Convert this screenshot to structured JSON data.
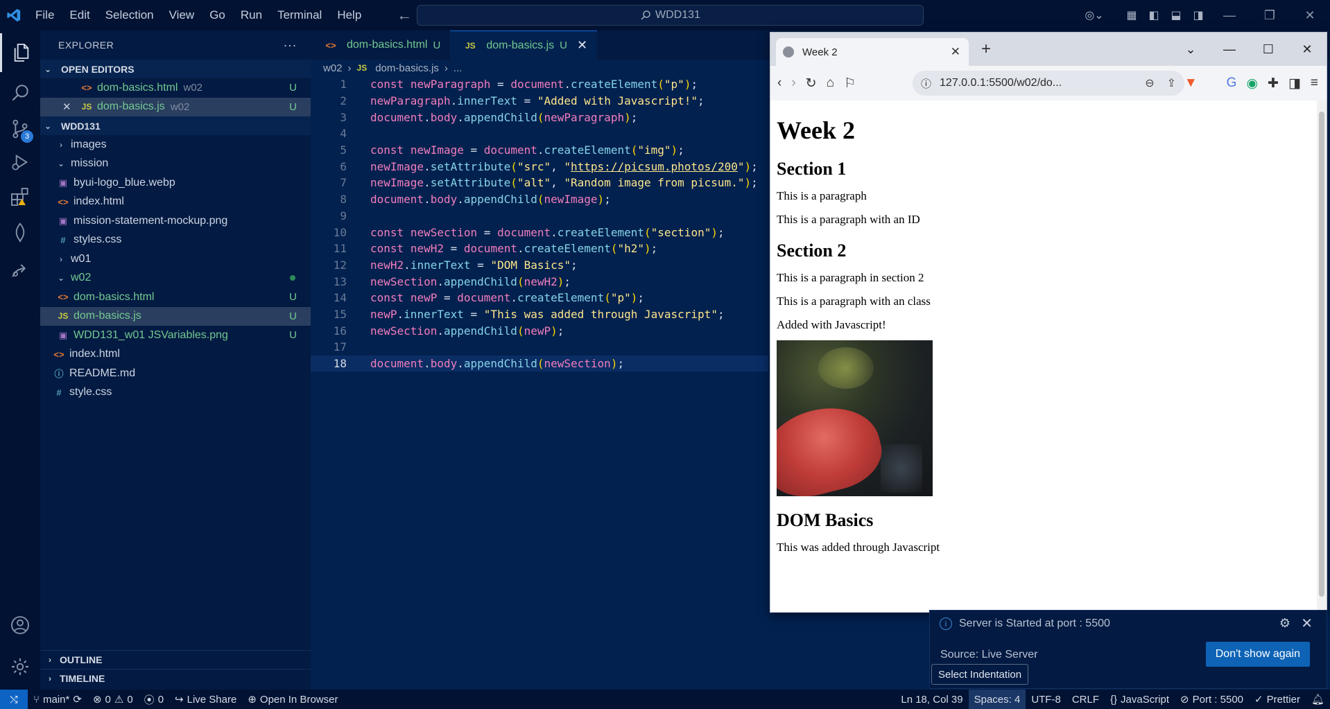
{
  "titlebar": {
    "menu": [
      "File",
      "Edit",
      "Selection",
      "View",
      "Go",
      "Run",
      "Terminal",
      "Help"
    ],
    "search_text": "WDD131"
  },
  "activity": {
    "source_control_badge": "3"
  },
  "explorer": {
    "title": "EXPLORER",
    "open_editors_label": "OPEN EDITORS",
    "open_editors": [
      {
        "name": "dom-basics.html",
        "dir": "w02",
        "status": "U"
      },
      {
        "name": "dom-basics.js",
        "dir": "w02",
        "status": "U"
      }
    ],
    "workspace_label": "WDD131",
    "tree": [
      {
        "name": "images"
      },
      {
        "name": "mission"
      },
      {
        "name": "byui-logo_blue.webp"
      },
      {
        "name": "index.html"
      },
      {
        "name": "mission-statement-mockup.png"
      },
      {
        "name": "styles.css"
      },
      {
        "name": "w01"
      },
      {
        "name": "w02"
      },
      {
        "name": "dom-basics.html",
        "status": "U"
      },
      {
        "name": "dom-basics.js",
        "status": "U"
      },
      {
        "name": "WDD131_w01 JSVariables.png",
        "status": "U"
      },
      {
        "name": "index.html"
      },
      {
        "name": "README.md"
      },
      {
        "name": "style.css"
      }
    ],
    "outline_label": "OUTLINE",
    "timeline_label": "TIMELINE"
  },
  "editor": {
    "tabs": [
      {
        "label": "dom-basics.html",
        "status": "U"
      },
      {
        "label": "dom-basics.js",
        "status": "U"
      }
    ],
    "breadcrumb": {
      "folder": "w02",
      "file": "dom-basics.js",
      "more": "..."
    },
    "line_numbers": [
      "1",
      "2",
      "3",
      "4",
      "5",
      "6",
      "7",
      "8",
      "9",
      "10",
      "11",
      "12",
      "13",
      "14",
      "15",
      "16",
      "17",
      "18"
    ]
  },
  "browser": {
    "tab_title": "Week 2",
    "url": "127.0.0.1:5500/w02/do...",
    "page": {
      "h1": "Week 2",
      "section1_heading": "Section 1",
      "p1": "This is a paragraph",
      "p2": "This is a paragraph with an ID",
      "section2_heading": "Section 2",
      "p3": "This is a paragraph in section 2",
      "p4": "This is a paragraph with an class",
      "p5": "Added with Javascript!",
      "dom_heading": "DOM Basics",
      "p6": "This was added through Javascript"
    }
  },
  "notification": {
    "message": "Server is Started at port : 5500",
    "source": "Source: Live Server",
    "button": "Don't show again",
    "tooltip": "Select Indentation"
  },
  "statusbar": {
    "branch": "main*",
    "errors": "0",
    "warnings": "0",
    "ports": "0",
    "live_share": "Live Share",
    "open_browser": "Open In Browser",
    "cursor": "Ln 18, Col 39",
    "spaces": "Spaces: 4",
    "encoding": "UTF-8",
    "eol": "CRLF",
    "language": "JavaScript",
    "port": "Port : 5500",
    "prettier": "Prettier"
  }
}
